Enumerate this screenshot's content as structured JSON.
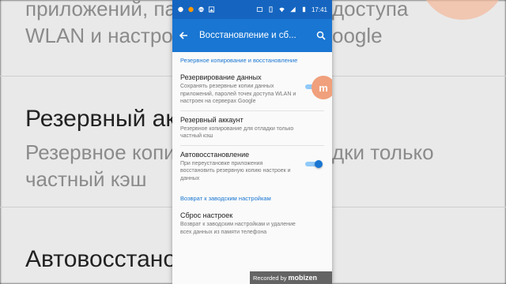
{
  "background": {
    "line1": "приложений, пар",
    "line1b": "доступа",
    "line2": "WLAN и настрое",
    "line2b": "oogle",
    "title1": "Резервный ак",
    "sub1": "Резервное копи",
    "sub1b": "дки только",
    "sub2": "частный кэш",
    "title2": "Автовосстано"
  },
  "status_bar": {
    "time": "17:41",
    "color": "#1565c0"
  },
  "toolbar": {
    "title": "Восстановление и сб...",
    "back_icon": "arrow-back-icon",
    "search_icon": "search-icon",
    "color": "#1976d2"
  },
  "sections": [
    {
      "header": "Резервное копирование и восстановление",
      "items": [
        {
          "title": "Резервирование данных",
          "subtitle": "Сохранять резервные копии данных приложений, паролей точек доступа WLAN и настроек на серверах Google",
          "toggle": true
        },
        {
          "title": "Резервный аккаунт",
          "subtitle": "Резервное копирование для отладки только частный кэш",
          "toggle": false
        },
        {
          "title": "Автовосстановление",
          "subtitle": "При переустановке приложения восстановить резервную копию настроек и данных",
          "toggle": true
        }
      ]
    },
    {
      "header": "Возврат к заводским настройкам",
      "items": [
        {
          "title": "Сброс настроек",
          "subtitle": "Возврат к заводским настройкам и удаление всех данных из памяти телефона",
          "toggle": false
        }
      ]
    }
  ],
  "overlay_badge": "m",
  "watermark": {
    "prefix": "Recorded by",
    "brand": "mobizen"
  }
}
